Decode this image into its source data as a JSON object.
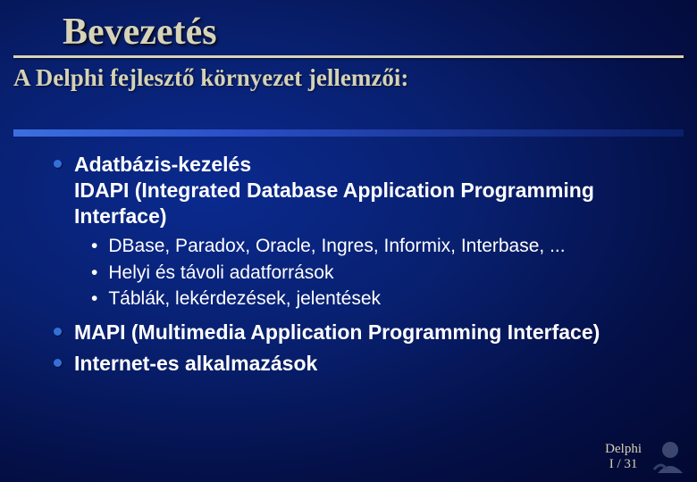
{
  "title": "Bevezetés",
  "subtitle": "A Delphi fejlesztő környezet jellemzői:",
  "bullets": [
    {
      "text": "Adatbázis-kezelés\nIDAPI (Integrated Database Application Programming Interface)",
      "sub": [
        "DBase, Paradox, Oracle, Ingres, Informix, Interbase, ...",
        "Helyi és távoli adatforrások",
        "Táblák, lekérdezések, jelentések"
      ]
    },
    {
      "text": "MAPI (Multimedia Application Programming Interface)",
      "sub": []
    },
    {
      "text": "Internet-es alkalmazások",
      "sub": []
    }
  ],
  "footer": {
    "line1": "Delphi",
    "line2": "I / 31"
  }
}
